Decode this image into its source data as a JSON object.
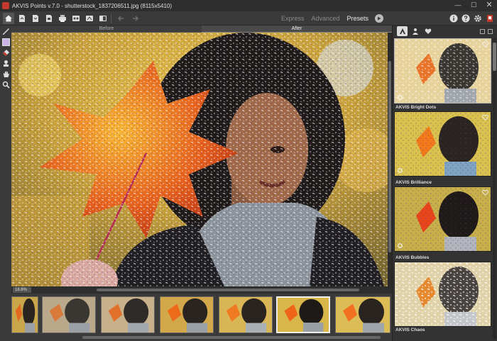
{
  "window": {
    "title": "AKVIS Points v.7.0 - shutterstock_1837206511.jpg (8115x5410)",
    "minimize": "—",
    "maximize": "☐",
    "close": "✕"
  },
  "toolbar": {
    "modes": [
      "Express",
      "Advanced",
      "Presets"
    ],
    "active_mode": "Presets",
    "icons": [
      "home-icon",
      "open-icon",
      "save-icon",
      "save-as-icon",
      "print-icon",
      "batch-icon",
      "share-icon",
      "compare-icon",
      "undo-icon",
      "redo-icon",
      "run-icon",
      "info-icon",
      "help-icon",
      "settings-icon",
      "bookmark-icon"
    ]
  },
  "canvas": {
    "tab_before": "Before",
    "tab_after": "After",
    "active_tab": "After",
    "zoom": "18.6%"
  },
  "tools": [
    "brush-icon",
    "color-swatch",
    "eraser-icon",
    "stamp-icon",
    "hand-icon",
    "zoom-icon"
  ],
  "presets": [
    {
      "name": "",
      "favorite": false
    },
    {
      "name": "AKVIS Bright Dots",
      "favorite": false
    },
    {
      "name": "AKVIS Brilliance",
      "favorite": false
    },
    {
      "name": "AKVIS Bubbles",
      "favorite": false
    },
    {
      "name": "AKVIS Chaos",
      "favorite": false
    }
  ],
  "filmstrip": {
    "count": 7,
    "selected_index": 4
  },
  "colors": {
    "accent": "#c0392b",
    "background": "#3c3c3c",
    "selection": "#eeeeee"
  }
}
